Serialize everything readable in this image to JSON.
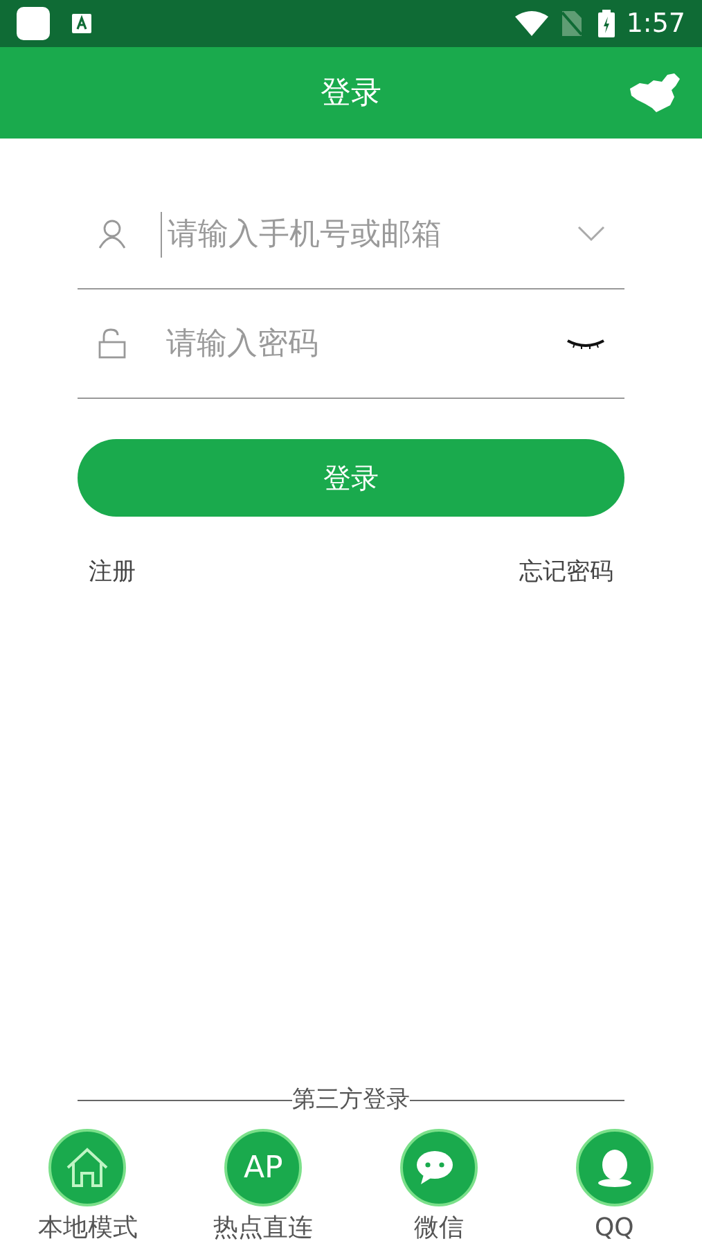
{
  "status_bar": {
    "time": "1:57"
  },
  "app_bar": {
    "title": "登录"
  },
  "fields": [
    {
      "kind": "account",
      "placeholder": "请输入手机号或邮箱",
      "focused": true
    },
    {
      "kind": "password",
      "placeholder": "请输入密码",
      "focused": false
    }
  ],
  "login_button": "登录",
  "links": [
    "注册",
    "忘记密码"
  ],
  "third_party": {
    "title": "第三方登录",
    "options": [
      {
        "kind": "home",
        "label": "本地模式"
      },
      {
        "kind": "text",
        "icon_text": "AP",
        "label": "热点直连"
      },
      {
        "kind": "chat",
        "label": "微信"
      },
      {
        "kind": "penguin",
        "label": "QQ"
      }
    ]
  }
}
